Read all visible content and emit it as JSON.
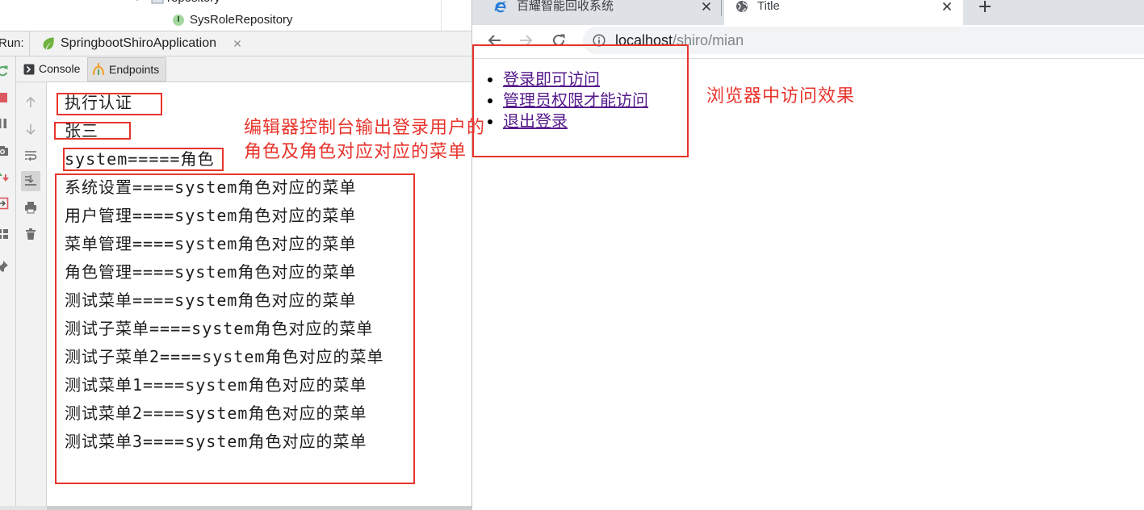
{
  "ide": {
    "project_tree": [
      {
        "label": "repository"
      },
      {
        "label": "SysRoleRepository",
        "badge": "I"
      }
    ],
    "run_bar": {
      "label": "Run:",
      "tab_label": "SpringbootShiroApplication"
    },
    "console_tabs": [
      {
        "label": "Console",
        "selected": true
      },
      {
        "label": "Endpoints",
        "selected": false
      }
    ],
    "left_toolbar_icons": [
      "rerun-icon",
      "stop-icon",
      "pause-icon",
      "camera-icon",
      "update-icon",
      "exit-icon",
      "layout-icon",
      "pin-icon"
    ],
    "console_toolbar_icons": [
      "up-arrow-icon",
      "down-arrow-icon",
      "soft-wrap-icon",
      "scroll-to-end-icon",
      "print-icon",
      "trash-icon"
    ],
    "console_lines": [
      "执行认证",
      "张三",
      "system=====角色",
      "系统设置====system角色对应的菜单",
      "用户管理====system角色对应的菜单",
      "菜单管理====system角色对应的菜单",
      "角色管理====system角色对应的菜单",
      "测试菜单====system角色对应的菜单",
      "测试子菜单====system角色对应的菜单",
      "测试子菜单2====system角色对应的菜单",
      "测试菜单1====system角色对应的菜单",
      "测试菜单2====system角色对应的菜单",
      "测试菜单3====system角色对应的菜单"
    ]
  },
  "browser": {
    "tabs": [
      {
        "title": "百耀智能回收系统",
        "icon": "ie-favicon-icon",
        "active": false
      },
      {
        "title": "Title",
        "icon": "globe-icon",
        "active": true
      }
    ],
    "nav_icons": [
      "back-arrow-icon",
      "forward-arrow-icon",
      "reload-icon",
      "info-icon"
    ],
    "url": {
      "host": "localhost",
      "path": "/shiro/mian"
    },
    "links": [
      "登录即可访问",
      "管理员权限才能访问",
      "退出登录"
    ]
  },
  "annotations": {
    "ide_note": [
      "编辑器控制台输出登录用户的",
      "角色及角色对应对应的菜单"
    ],
    "browser_note": "浏览器中访问效果"
  },
  "colors": {
    "annotation_red": "#e8342c",
    "visited_link": "#551a8b",
    "ide_panel_bg": "#f2f2f2",
    "browser_tabstrip_bg": "#dee1e6",
    "omnibox_bg": "#f1f3f4",
    "spring_green": "#6db33f"
  }
}
